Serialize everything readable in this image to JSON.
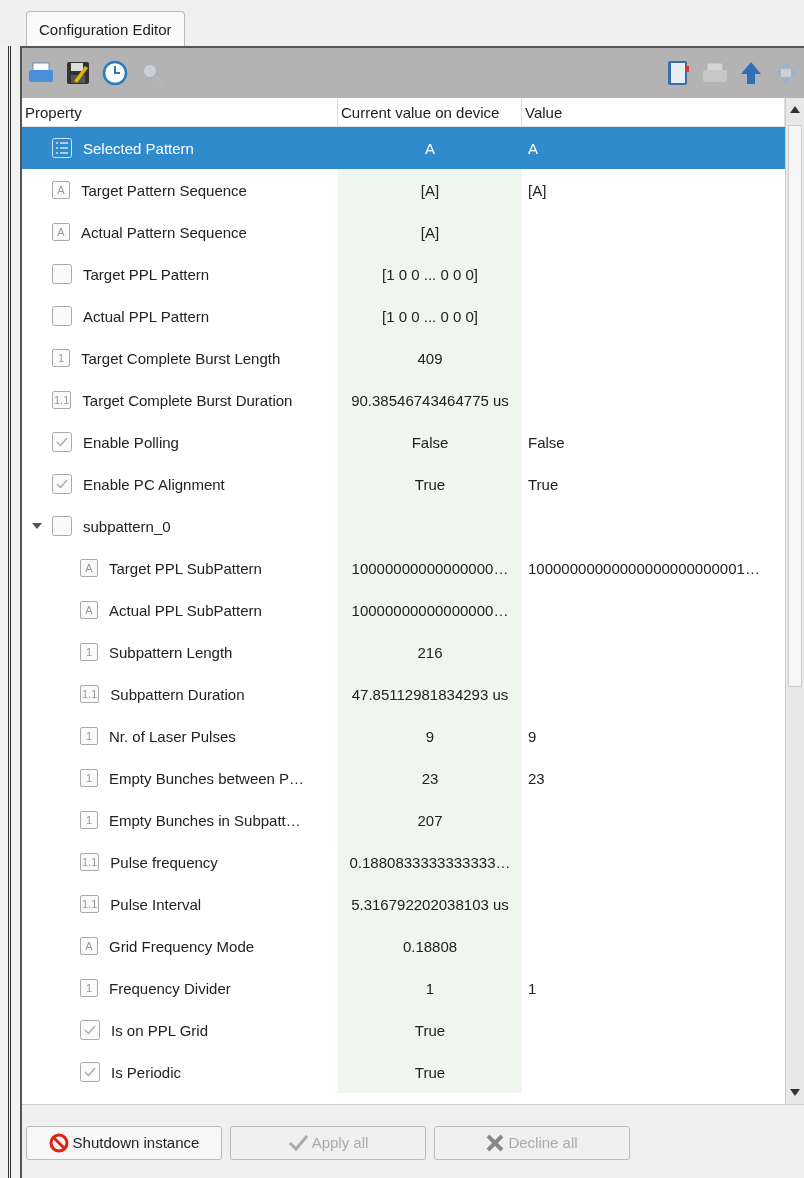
{
  "tab": {
    "label": "Configuration Editor",
    "selected": true
  },
  "toolbar": {
    "left": [
      {
        "kind": "tray",
        "disabled": false
      },
      {
        "kind": "floppy",
        "disabled": false
      },
      {
        "kind": "clock",
        "disabled": false
      },
      {
        "kind": "magnifier",
        "disabled": true
      }
    ],
    "right": [
      {
        "kind": "book",
        "disabled": false
      },
      {
        "kind": "tray",
        "disabled": true
      },
      {
        "kind": "up",
        "disabled": false
      },
      {
        "kind": "move",
        "disabled": true
      }
    ]
  },
  "columns": [
    "Property",
    "Current value on device",
    "Value"
  ],
  "rows": [
    {
      "name": "Selected Pattern",
      "icon": {
        "kind": "list"
      },
      "device": "A",
      "value": "A",
      "selected": true
    },
    {
      "name": "Target Pattern Sequence",
      "icon": {
        "kind": "text",
        "label": "A"
      },
      "device": "[A]",
      "value": "[A]",
      "selected": false
    },
    {
      "name": "Actual Pattern Sequence",
      "icon": {
        "kind": "text",
        "label": "A"
      },
      "device": "[A]",
      "selected": false
    },
    {
      "name": "Target PPL Pattern",
      "icon": {
        "kind": "blank"
      },
      "device": "[1 0 0 ... 0 0 0]",
      "selected": false
    },
    {
      "name": "Actual PPL Pattern",
      "icon": {
        "kind": "blank"
      },
      "device": "[1 0 0 ... 0 0 0]",
      "selected": false
    },
    {
      "name": "Target Complete Burst Length",
      "icon": {
        "kind": "text",
        "label": "1"
      },
      "device": "409",
      "selected": false
    },
    {
      "name": "Target Complete Burst Duration",
      "icon": {
        "kind": "text",
        "label": "1.1"
      },
      "device": "90.38546743464775 us",
      "selected": false
    },
    {
      "name": "Enable Polling",
      "icon": {
        "kind": "check"
      },
      "device": "False",
      "value": "False",
      "selected": false
    },
    {
      "name": "Enable PC Alignment",
      "icon": {
        "kind": "check"
      },
      "device": "True",
      "value": "True",
      "selected": false
    },
    {
      "name": "subpattern_0",
      "icon": {
        "kind": "blank"
      },
      "selected": false,
      "expanded": true,
      "children": [
        {
          "name": "Target PPL SubPattern",
          "icon": {
            "kind": "text",
            "label": "A"
          },
          "device": "10000000000000000…",
          "value": "10000000000000000000000001…",
          "selected": false
        },
        {
          "name": "Actual PPL SubPattern",
          "icon": {
            "kind": "text",
            "label": "A"
          },
          "device": "10000000000000000…",
          "selected": false
        },
        {
          "name": "Subpattern Length",
          "icon": {
            "kind": "text",
            "label": "1"
          },
          "device": "216",
          "selected": false
        },
        {
          "name": "Subpattern Duration",
          "icon": {
            "kind": "text",
            "label": "1.1"
          },
          "device": "47.85112981834293 us",
          "selected": false
        },
        {
          "name": "Nr. of Laser Pulses",
          "icon": {
            "kind": "text",
            "label": "1"
          },
          "device": "9",
          "value": "9",
          "selected": false
        },
        {
          "name": "Empty Bunches between P…",
          "icon": {
            "kind": "text",
            "label": "1"
          },
          "device": "23",
          "value": "23",
          "selected": false
        },
        {
          "name": "Empty Bunches in Subpatt…",
          "icon": {
            "kind": "text",
            "label": "1"
          },
          "device": "207",
          "selected": false
        },
        {
          "name": "Pulse frequency",
          "icon": {
            "kind": "text",
            "label": "1.1"
          },
          "device": "0.1880833333333333…",
          "selected": false
        },
        {
          "name": "Pulse Interval",
          "icon": {
            "kind": "text",
            "label": "1.1"
          },
          "device": "5.316792202038103 us",
          "selected": false
        },
        {
          "name": "Grid Frequency Mode",
          "icon": {
            "kind": "text",
            "label": "A"
          },
          "device": "0.18808",
          "selected": false
        },
        {
          "name": "Frequency Divider",
          "icon": {
            "kind": "text",
            "label": "1"
          },
          "device": "1",
          "value": "1",
          "selected": false
        },
        {
          "name": "Is on PPL Grid",
          "icon": {
            "kind": "check"
          },
          "device": "True",
          "selected": false
        },
        {
          "name": "Is Periodic",
          "icon": {
            "kind": "check"
          },
          "device": "True",
          "selected": false
        }
      ]
    }
  ],
  "buttons": [
    {
      "label": "Shutdown instance",
      "kind": "stop",
      "disabled": false
    },
    {
      "label": "Apply all",
      "kind": "tick",
      "disabled": true
    },
    {
      "label": "Decline all",
      "kind": "cross",
      "disabled": true
    }
  ]
}
